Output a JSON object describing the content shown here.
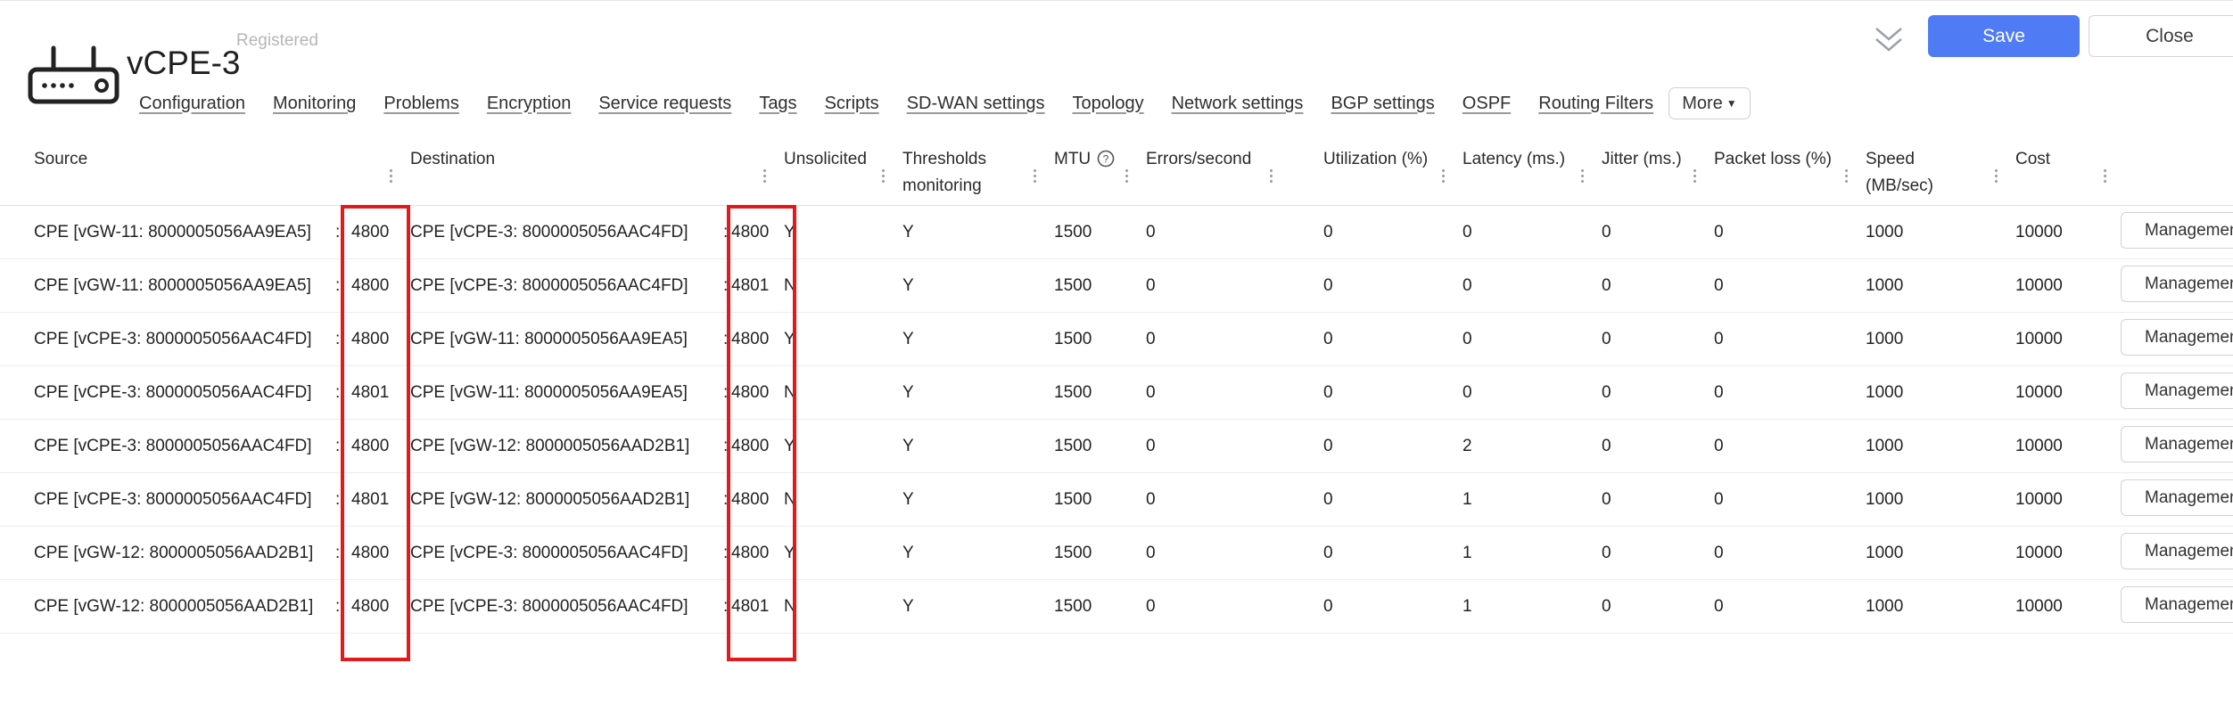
{
  "header": {
    "title": "vCPE-3",
    "status": "Registered",
    "save_label": "Save",
    "close_label": "Close",
    "device_icon": "router-icon",
    "collapse_icon": "double-chevron-down-icon"
  },
  "tabs": [
    "Configuration",
    "Monitoring",
    "Problems",
    "Encryption",
    "Service requests",
    "Tags",
    "Scripts",
    "SD-WAN settings",
    "Topology",
    "Network settings",
    "BGP settings",
    "OSPF",
    "Routing Filters"
  ],
  "more_label": "More",
  "columns": {
    "source": "Source",
    "destination": "Destination",
    "unsolicited": "Unsolicited",
    "thresholds_1": "Thresholds",
    "thresholds_2": "monitoring",
    "mtu": "MTU",
    "errors": "Errors/second",
    "utilization": "Utilization (%)",
    "latency": "Latency (ms.)",
    "jitter": "Jitter (ms.)",
    "packet_loss": "Packet loss (%)",
    "speed_1": "Speed",
    "speed_2": "(MB/sec)",
    "cost": "Cost"
  },
  "rows": [
    {
      "src": "CPE [vGW-11: 8000005056AA9EA5]",
      "src_port": "4800",
      "dst": "CPE [vCPE-3: 8000005056AAC4FD]",
      "dst_port": "4800",
      "unsol": "Y",
      "thr": "Y",
      "mtu": "1500",
      "err": "0",
      "util": "0",
      "lat": "0",
      "jit": "0",
      "loss": "0",
      "speed": "1000",
      "cost": "10000",
      "action": "Management"
    },
    {
      "src": "CPE [vGW-11: 8000005056AA9EA5]",
      "src_port": "4800",
      "dst": "CPE [vCPE-3: 8000005056AAC4FD]",
      "dst_port": "4801",
      "unsol": "N",
      "thr": "Y",
      "mtu": "1500",
      "err": "0",
      "util": "0",
      "lat": "0",
      "jit": "0",
      "loss": "0",
      "speed": "1000",
      "cost": "10000",
      "action": "Management"
    },
    {
      "src": "CPE [vCPE-3: 8000005056AAC4FD]",
      "src_port": "4800",
      "dst": "CPE [vGW-11: 8000005056AA9EA5]",
      "dst_port": "4800",
      "unsol": "Y",
      "thr": "Y",
      "mtu": "1500",
      "err": "0",
      "util": "0",
      "lat": "0",
      "jit": "0",
      "loss": "0",
      "speed": "1000",
      "cost": "10000",
      "action": "Management"
    },
    {
      "src": "CPE [vCPE-3: 8000005056AAC4FD]",
      "src_port": "4801",
      "dst": "CPE [vGW-11: 8000005056AA9EA5]",
      "dst_port": "4800",
      "unsol": "N",
      "thr": "Y",
      "mtu": "1500",
      "err": "0",
      "util": "0",
      "lat": "0",
      "jit": "0",
      "loss": "0",
      "speed": "1000",
      "cost": "10000",
      "action": "Management"
    },
    {
      "src": "CPE [vCPE-3: 8000005056AAC4FD]",
      "src_port": "4800",
      "dst": "CPE [vGW-12: 8000005056AAD2B1]",
      "dst_port": "4800",
      "unsol": "Y",
      "thr": "Y",
      "mtu": "1500",
      "err": "0",
      "util": "0",
      "lat": "2",
      "jit": "0",
      "loss": "0",
      "speed": "1000",
      "cost": "10000",
      "action": "Management"
    },
    {
      "src": "CPE [vCPE-3: 8000005056AAC4FD]",
      "src_port": "4801",
      "dst": "CPE [vGW-12: 8000005056AAD2B1]",
      "dst_port": "4800",
      "unsol": "N",
      "thr": "Y",
      "mtu": "1500",
      "err": "0",
      "util": "0",
      "lat": "1",
      "jit": "0",
      "loss": "0",
      "speed": "1000",
      "cost": "10000",
      "action": "Management"
    },
    {
      "src": "CPE [vGW-12: 8000005056AAD2B1]",
      "src_port": "4800",
      "dst": "CPE [vCPE-3: 8000005056AAC4FD]",
      "dst_port": "4800",
      "unsol": "Y",
      "thr": "Y",
      "mtu": "1500",
      "err": "0",
      "util": "0",
      "lat": "1",
      "jit": "0",
      "loss": "0",
      "speed": "1000",
      "cost": "10000",
      "action": "Management"
    },
    {
      "src": "CPE [vGW-12: 8000005056AAD2B1]",
      "src_port": "4800",
      "dst": "CPE [vCPE-3: 8000005056AAC4FD]",
      "dst_port": "4801",
      "unsol": "N",
      "thr": "Y",
      "mtu": "1500",
      "err": "0",
      "util": "0",
      "lat": "1",
      "jit": "0",
      "loss": "0",
      "speed": "1000",
      "cost": "10000",
      "action": "Management"
    }
  ],
  "colors": {
    "accent": "#4f7cf4",
    "highlight": "#e3191c"
  }
}
